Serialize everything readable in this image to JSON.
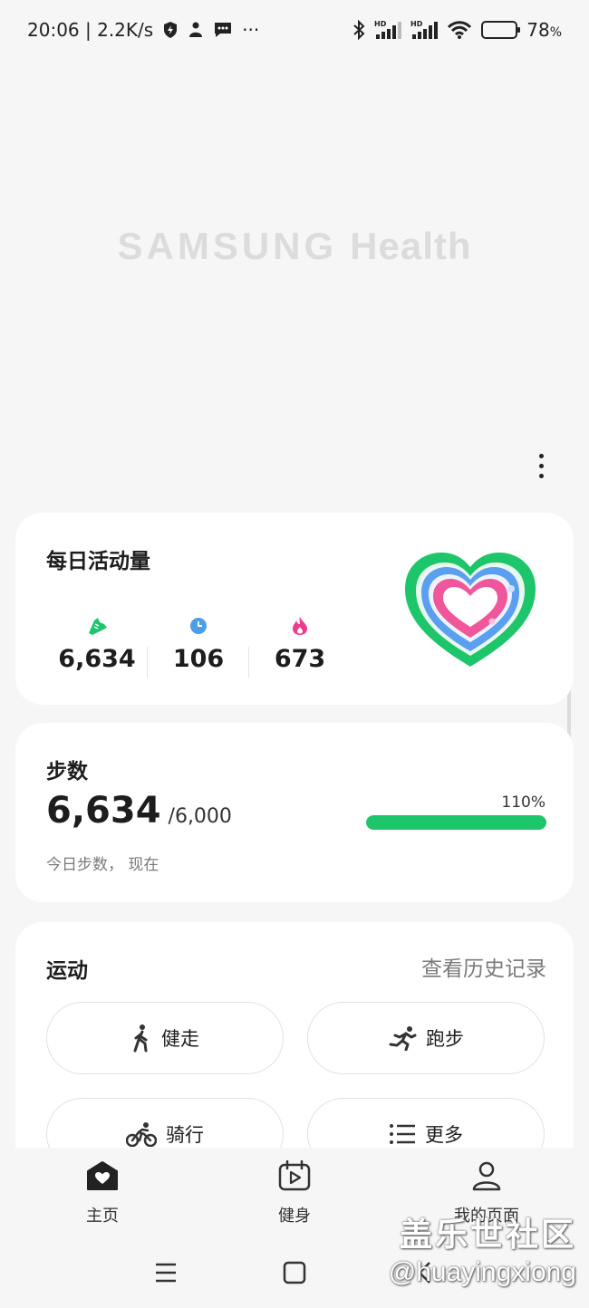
{
  "status_bar": {
    "time_speed": "20:06 | 2.2K/s",
    "dots": "···",
    "battery": "78",
    "battery_unit": "%",
    "battery_level": 0.78
  },
  "splash": {
    "brand_main": "SAMSUNG",
    "brand_sub": "Health"
  },
  "activity": {
    "title": "每日活动量",
    "metrics": [
      {
        "icon": "shoe-icon",
        "value": "6,634",
        "color": "#1dc66a"
      },
      {
        "icon": "clock-icon",
        "value": "106",
        "color": "#4a9eea"
      },
      {
        "icon": "flame-icon",
        "value": "673",
        "color": "#ee3b8b"
      }
    ]
  },
  "steps": {
    "title": "步数",
    "value": "6,634",
    "goal": "/6,000",
    "subtitle": "今日步数， 现在",
    "percent": "110%",
    "progress": 1.0,
    "color": "#1dc66a"
  },
  "exercise": {
    "title": "运动",
    "history_link": "查看历史记录",
    "buttons": [
      {
        "label": "健走",
        "icon": "walk-icon"
      },
      {
        "label": "跑步",
        "icon": "run-icon"
      },
      {
        "label": "骑行",
        "icon": "bike-icon"
      },
      {
        "label": "更多",
        "icon": "list-icon"
      }
    ]
  },
  "bottom_nav": {
    "items": [
      {
        "label": "主页",
        "icon": "home-icon"
      },
      {
        "label": "健身",
        "icon": "fitness-icon"
      },
      {
        "label": "我的页面",
        "icon": "profile-icon"
      }
    ]
  },
  "watermark": {
    "line1": "盖乐世社区",
    "line2": "@huayingxiong"
  }
}
